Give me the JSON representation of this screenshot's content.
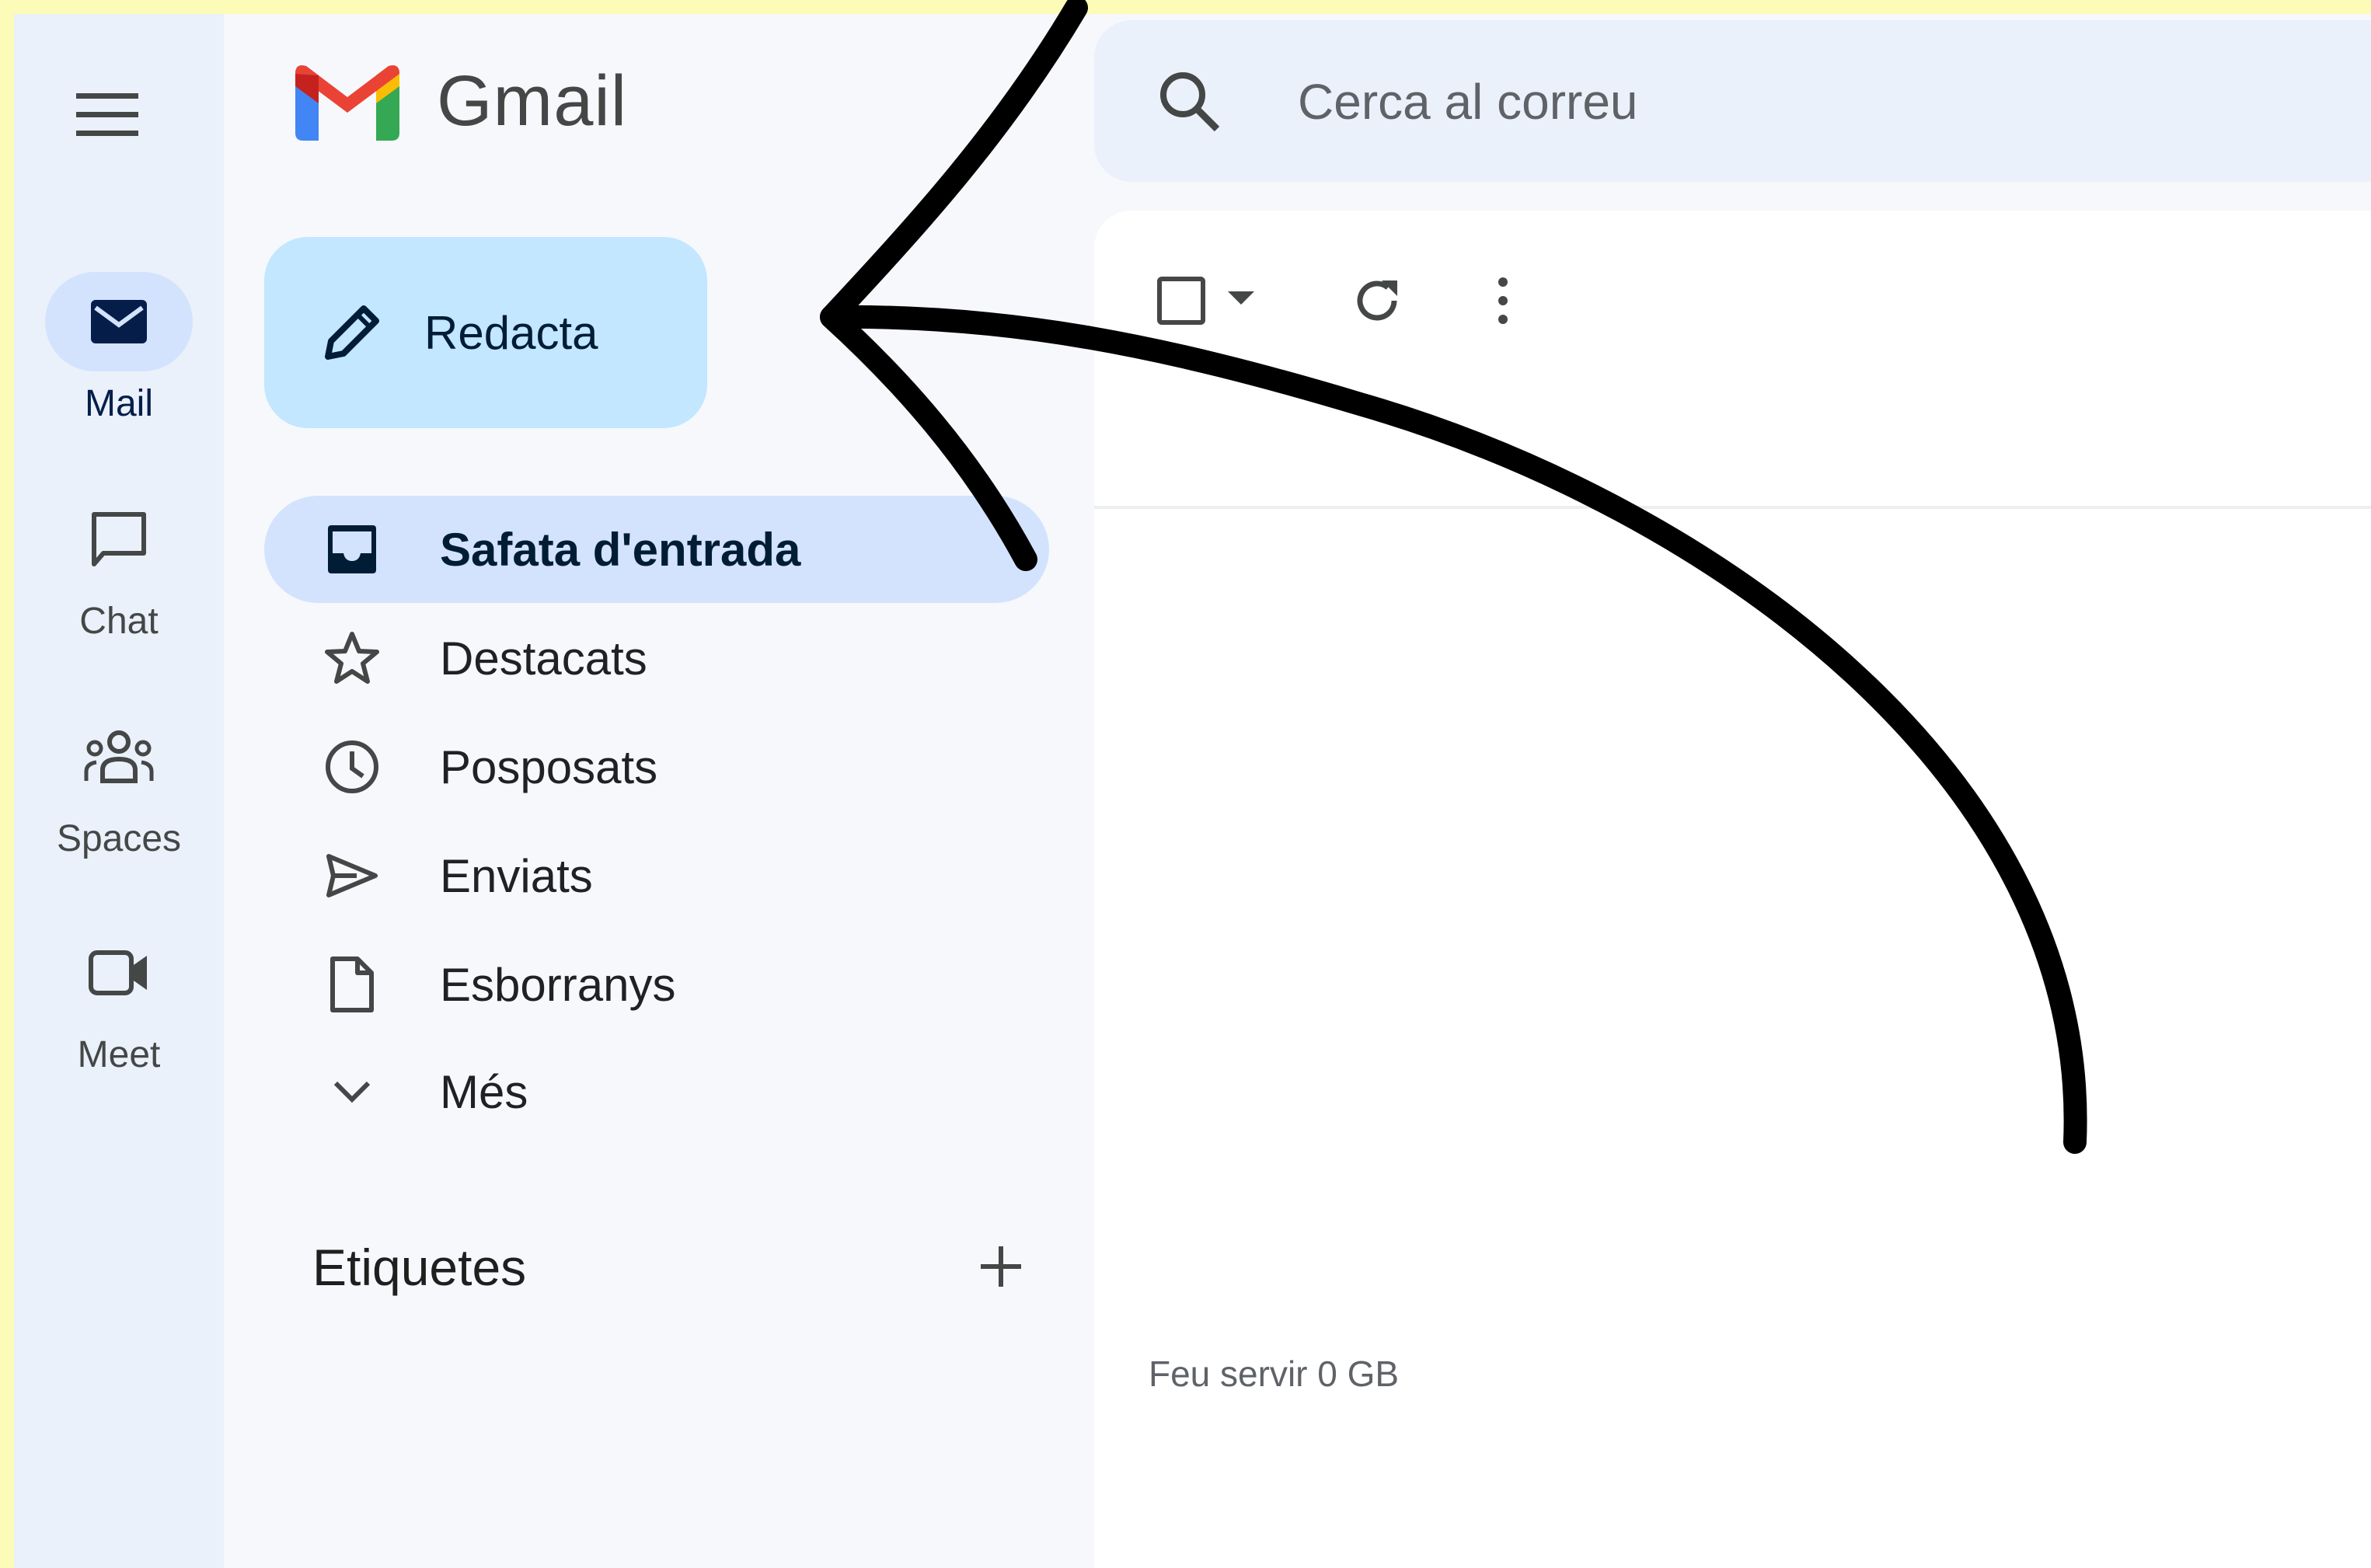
{
  "app": {
    "name": "Gmail"
  },
  "rail": {
    "menu_icon": "hamburger-menu-icon",
    "items": [
      {
        "label": "Mail",
        "icon": "mail-icon",
        "active": true
      },
      {
        "label": "Chat",
        "icon": "chat-bubble-icon",
        "active": false
      },
      {
        "label": "Spaces",
        "icon": "people-group-icon",
        "active": false
      },
      {
        "label": "Meet",
        "icon": "video-camera-icon",
        "active": false
      }
    ]
  },
  "nav": {
    "compose_label": "Redacta",
    "compose_icon": "pencil-icon",
    "folders": [
      {
        "label": "Safata d'entrada",
        "icon": "inbox-icon",
        "active": true
      },
      {
        "label": "Destacats",
        "icon": "star-icon",
        "active": false
      },
      {
        "label": "Posposats",
        "icon": "clock-icon",
        "active": false
      },
      {
        "label": "Enviats",
        "icon": "send-icon",
        "active": false
      },
      {
        "label": "Esborranys",
        "icon": "draft-file-icon",
        "active": false
      },
      {
        "label": "Més",
        "icon": "chevron-down-icon",
        "active": false
      }
    ],
    "labels_heading": "Etiquetes",
    "labels_add_icon": "plus-icon"
  },
  "search": {
    "placeholder": "Cerca al correu",
    "icon": "search-icon"
  },
  "toolbar": {
    "select_icon": "checkbox-icon",
    "select_dropdown_icon": "caret-down-icon",
    "refresh_icon": "refresh-icon",
    "more_icon": "more-vert-icon"
  },
  "footer": {
    "storage_text": "Feu servir 0 GB"
  },
  "colors": {
    "border_highlight": "#fdfbb8",
    "rail_bg": "#eaf1fb",
    "nav_bg": "#f6f8fc",
    "compose_bg": "#c2e7ff",
    "active_bg": "#d3e3fd",
    "annotation_arrow": "#000000"
  },
  "annotation": {
    "type": "hand-drawn-arrow",
    "points_to": "compose-button"
  }
}
